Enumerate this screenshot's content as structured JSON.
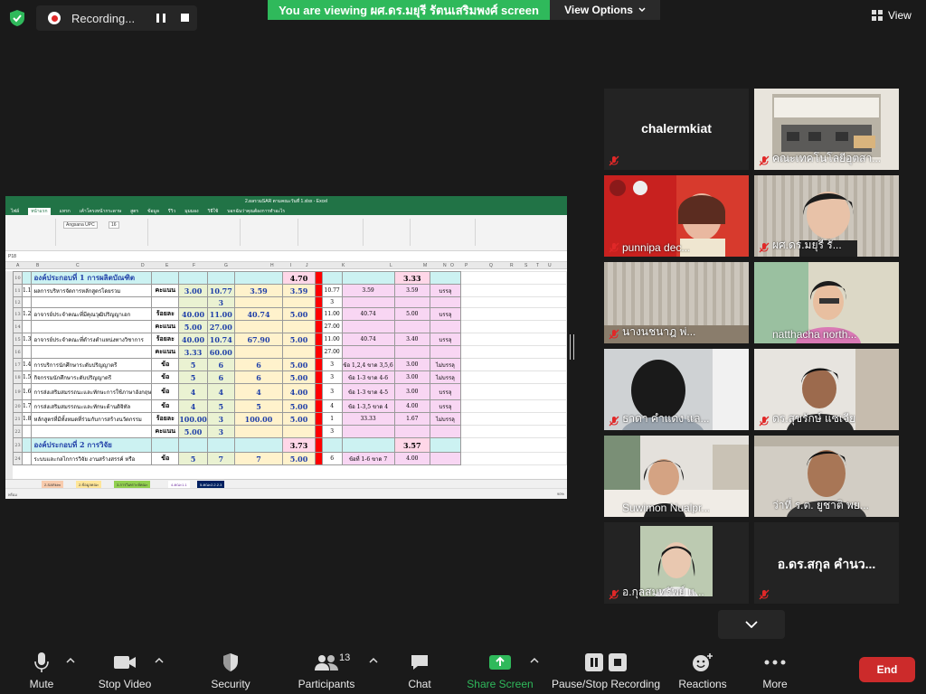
{
  "topbar": {
    "recording_label": "Recording...",
    "viewing_banner": "You are viewing ผศ.ดร.มยุรี  รัตนเสริมพงศ์ screen",
    "view_options_label": "View Options",
    "view_label": "View"
  },
  "excel": {
    "title": "2.ผลรวมSAR ตามคณะวันที่ 1.xlsx - Excel",
    "tabs": [
      "ไฟล์",
      "หน้าแรก",
      "แทรก",
      "เค้าโครงหน้ากระดาษ",
      "สูตร",
      "ข้อมูล",
      "รีวิว",
      "มุมมอง",
      "วิธีใช้",
      "บอกฉันว่าคุณต้องการทำอะไร"
    ],
    "cell_ref": "P18",
    "font_name": "Angsana UPC",
    "font_size": "16",
    "col_letters": [
      "A",
      "B",
      "C",
      "D",
      "E",
      "F",
      "G",
      "H",
      "I",
      "J",
      "K",
      "L",
      "M",
      "N",
      "O",
      "P",
      "Q",
      "R",
      "S",
      "T",
      "U"
    ],
    "rows": [
      {
        "num": "10",
        "label": "องค์ประกอบที่ 1 การผลิตบัณฑิต",
        "h": "4.70",
        "l": "3.33"
      },
      {
        "num": "11",
        "idx": "1.1",
        "label": "ผลการบริหารจัดการหลักสูตรโดยรวม",
        "d": "คะแนน",
        "e": "3.00",
        "f": "10.77",
        "g": "3.59",
        "h": "3.59",
        "j": "10.77",
        "k": "3.59",
        "l": "3.59",
        "m": "บรรลุ"
      },
      {
        "num": "12",
        "f": "3",
        "j": "3"
      },
      {
        "num": "13",
        "idx": "1.2",
        "label": "อาจารย์ประจำคณะที่มีคุณวุฒิปริญญาเอก",
        "d": "ร้อยละ",
        "e": "40.00",
        "f": "11.00",
        "g": "40.74",
        "h": "5.00",
        "j": "11.00",
        "k": "40.74",
        "l": "5.00",
        "m": "บรรลุ"
      },
      {
        "num": "14",
        "d": "คะแนน",
        "e": "5.00",
        "f": "27.00",
        "j": "27.00"
      },
      {
        "num": "15",
        "idx": "1.3",
        "label": "อาจารย์ประจำคณะที่ดำรงตำแหน่งทางวิชาการ",
        "d": "ร้อยละ",
        "e": "40.00",
        "f": "10.74",
        "g": "67.90",
        "h": "5.00",
        "j": "11.00",
        "k": "40.74",
        "l": "3.40",
        "m": "บรรลุ"
      },
      {
        "num": "16",
        "d": "คะแนน",
        "e": "3.33",
        "f": "60.00",
        "j": "27.00"
      },
      {
        "num": "17",
        "idx": "1.4",
        "label": "การบริการนักศึกษาระดับปริญญาตรี",
        "d": "ข้อ",
        "e": "5",
        "f": "6",
        "g": "6",
        "h": "5.00",
        "j": "3",
        "k": "ข้อ 1,2,4 ขาด 3,5,6",
        "l": "3.00",
        "m": "ไม่บรรลุ"
      },
      {
        "num": "18",
        "idx": "1.5",
        "label": "กิจกรรมนักศึกษาระดับปริญญาตรี",
        "d": "ข้อ",
        "e": "5",
        "f": "6",
        "g": "6",
        "h": "5.00",
        "j": "3",
        "k": "ข้อ 1-3 ขาด 4-6",
        "l": "3.00",
        "m": "ไม่บรรลุ"
      },
      {
        "num": "19",
        "idx": "1.6",
        "label": "การส่งเสริมสมรรถนะและทักษะการใช้ภาษาอังกฤษ",
        "d": "ข้อ",
        "e": "4",
        "f": "4",
        "g": "4",
        "h": "4.00",
        "j": "3",
        "k": "ข้อ 1-3 ขาด 4-5",
        "l": "3.00",
        "m": "บรรลุ"
      },
      {
        "num": "20",
        "idx": "1.7",
        "label": "การส่งเสริมสมรรถนะและทักษะด้านดิจิทัล",
        "d": "ข้อ",
        "e": "4",
        "f": "5",
        "g": "5",
        "h": "5.00",
        "j": "4",
        "k": "ข้อ 1-3,5 ขาด 4",
        "l": "4.00",
        "m": "บรรลุ"
      },
      {
        "num": "21",
        "idx": "1.8",
        "label": "หลักสูตรที่มีทั้งหมดที่ร่วมกับการสร้างนวัตกรรม",
        "d": "ร้อยละ",
        "e": "100.00",
        "f": "3",
        "g": "100.00",
        "h": "5.00",
        "j": "1",
        "k": "33.33",
        "l": "1.67",
        "m": "ไม่บรรลุ"
      },
      {
        "num": "22",
        "d": "คะแนน",
        "e": "5.00",
        "f": "3",
        "j": "3"
      },
      {
        "num": "23",
        "label": "องค์ประกอบที่ 2 การวิจัย",
        "h": "3.73",
        "l": "3.57"
      },
      {
        "num": "24",
        "label": "ระบบและกลไกการวิจัย งานสร้างสรรค์ หรือ",
        "d": "ข้อ",
        "e": "5",
        "f": "7",
        "g": "7",
        "h": "5.00",
        "j": "6",
        "k": "ข้อที่ 1-6 ขาด 7",
        "l": "4.00"
      }
    ],
    "sheet_tabs": [
      "2-SARkim",
      "2-ข้อมูลคณะ",
      "3-การวิเคราะห์คณะ",
      "4-คณะ1.1",
      "5-คณะ2.2.2.3"
    ],
    "status_ready": "พร้อม",
    "zoom": "90%"
  },
  "participants": [
    {
      "name": "chalermkiat",
      "video": false,
      "muted": true
    },
    {
      "name": "คณะเทคโนโลยีอุตสา...",
      "video": true,
      "muted": true
    },
    {
      "name": "punnipa dec...",
      "video": true,
      "muted": true
    },
    {
      "name": "ผศ.ดร.มยุรี  รั...",
      "video": true,
      "muted": true
    },
    {
      "name": "นางนชนาฎ  พ่...",
      "video": true,
      "muted": true
    },
    {
      "name": "natthacha north...",
      "video": true,
      "muted": false,
      "active": true
    },
    {
      "name": "ธาดา คำแดง แล...",
      "video": true,
      "muted": true
    },
    {
      "name": "ดร.สุขรักษ์ แซเจีย",
      "video": true,
      "muted": true
    },
    {
      "name": "Suwimon Nualpr...",
      "video": true,
      "muted": false
    },
    {
      "name": "ว่าที่ ร.ต. ยูชาติ พย...",
      "video": true,
      "muted": false
    },
    {
      "name": "อ.กุลสมทรัพย์ แ...",
      "video": true,
      "muted": true
    },
    {
      "name": "อ.ดร.สกุล  คำนว...",
      "video": false,
      "muted": true
    }
  ],
  "toolbar": {
    "mute": "Mute",
    "stop_video": "Stop Video",
    "security": "Security",
    "participants": "Participants",
    "participant_count": "13",
    "chat": "Chat",
    "share_screen": "Share Screen",
    "pause_stop_recording": "Pause/Stop Recording",
    "reactions": "Reactions",
    "more": "More",
    "end": "End"
  },
  "colors": {
    "zoom_green": "#2fb95b",
    "excel_green": "#217346",
    "active_speaker": "#e8e461",
    "end_red": "#cc2b2b",
    "muted_red": "#e02828"
  }
}
